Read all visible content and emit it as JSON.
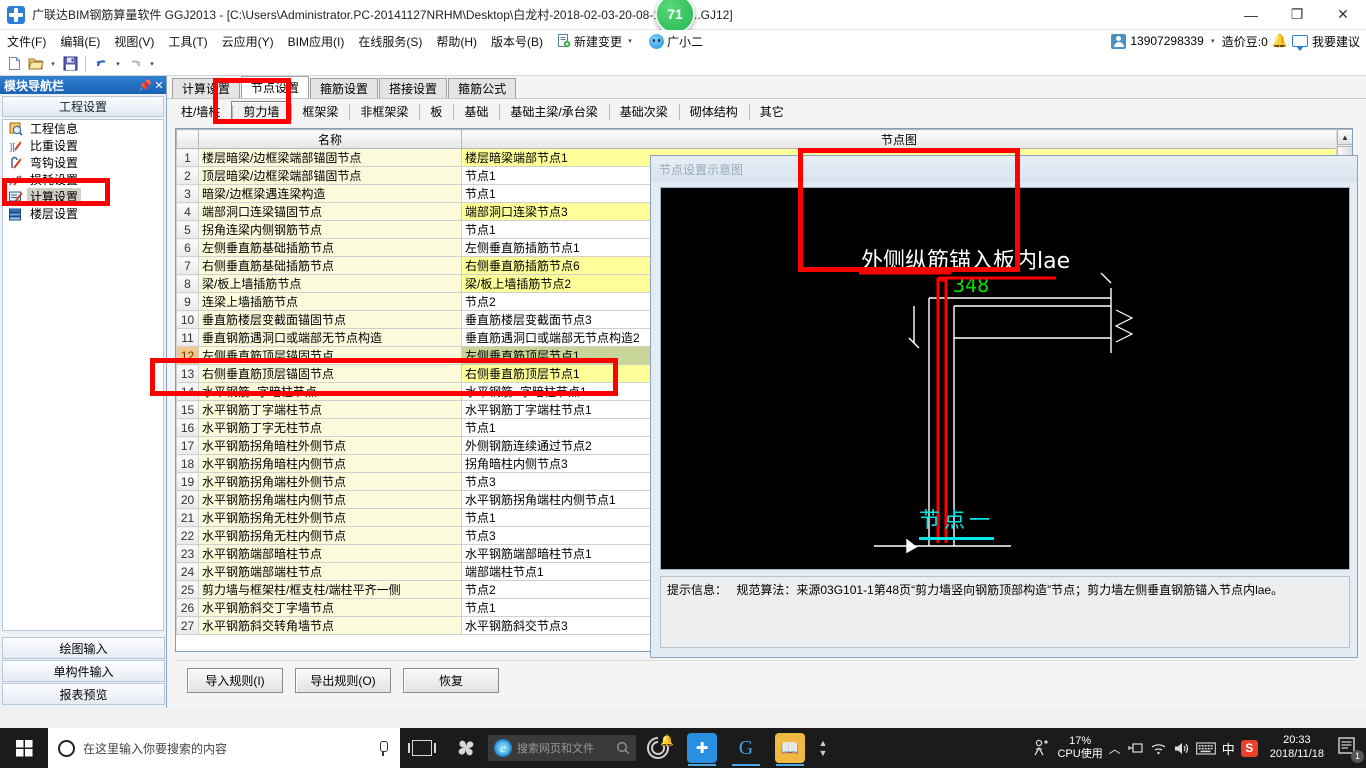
{
  "window": {
    "app_icon": "grandsoft-logo-icon",
    "title": "广联达BIM钢筋算量软件 GGJ2013 - [C:\\Users\\Administrator.PC-20141127NRHM\\Desktop\\白龙村-2018-02-03-20-08-17(266...GJ12]",
    "badge": "71",
    "minimize": "—",
    "maximize": "❐",
    "close": "✕"
  },
  "menubar": {
    "items": [
      "文件(F)",
      "编辑(E)",
      "视图(V)",
      "工具(T)",
      "云应用(Y)",
      "BIM应用(I)",
      "在线服务(S)",
      "帮助(H)",
      "版本号(B)"
    ],
    "new_change": "新建变更",
    "new_change_caret": "▾",
    "user_name": "广小二",
    "account": "13907298339",
    "account_caret": "▾",
    "beans": "造价豆:0",
    "suggest": "我要建议"
  },
  "toolbar": {
    "new_icon": "new-document-icon",
    "open_icon": "open-folder-icon",
    "save_icon": "save-disk-icon",
    "undo_icon": "undo-arrow-icon",
    "redo_icon": "redo-arrow-icon",
    "caret": "▾"
  },
  "sidebar": {
    "title": "模块导航栏",
    "pin_icon": "pin-icon",
    "close_icon": "close-icon",
    "group_title": "工程设置",
    "items": [
      {
        "label": "工程信息",
        "icon": "project-info-icon",
        "selected": false
      },
      {
        "label": "比重设置",
        "icon": "weight-setting-icon",
        "selected": false
      },
      {
        "label": "弯钩设置",
        "icon": "hook-setting-icon",
        "selected": false
      },
      {
        "label": "损耗设置",
        "icon": "loss-setting-icon",
        "selected": false
      },
      {
        "label": "计算设置",
        "icon": "calc-setting-icon",
        "selected": true
      },
      {
        "label": "楼层设置",
        "icon": "floor-setting-icon",
        "selected": false
      }
    ],
    "bottom_buttons": [
      "绘图输入",
      "单构件输入",
      "报表预览"
    ]
  },
  "tabs_primary": [
    {
      "label": "计算设置",
      "active": false
    },
    {
      "label": "节点设置",
      "active": true
    },
    {
      "label": "箍筋设置",
      "active": false
    },
    {
      "label": "搭接设置",
      "active": false
    },
    {
      "label": "箍筋公式",
      "active": false
    }
  ],
  "tabs_secondary": [
    {
      "label": "柱/墙柱",
      "active": false
    },
    {
      "label": "剪力墙",
      "active": true
    },
    {
      "label": "框架梁",
      "active": false
    },
    {
      "label": "非框架梁",
      "active": false
    },
    {
      "label": "板",
      "active": false
    },
    {
      "label": "基础",
      "active": false
    },
    {
      "label": "基础主梁/承台梁",
      "active": false
    },
    {
      "label": "基础次梁",
      "active": false
    },
    {
      "label": "砌体结构",
      "active": false
    },
    {
      "label": "其它",
      "active": false
    }
  ],
  "table": {
    "columns": [
      "",
      "名称",
      "节点图"
    ],
    "rows": [
      {
        "num": "1",
        "name": "楼层暗梁/边框梁端部锚固节点",
        "node": "楼层暗梁端部节点1",
        "node_highlight": true,
        "selected": false
      },
      {
        "num": "2",
        "name": "顶层暗梁/边框梁端部锚固节点",
        "node": "节点1",
        "node_highlight": false,
        "selected": false
      },
      {
        "num": "3",
        "name": "暗梁/边框梁遇连梁构造",
        "node": "节点1",
        "node_highlight": false,
        "selected": false
      },
      {
        "num": "4",
        "name": "端部洞口连梁锚固节点",
        "node": "端部洞口连梁节点3",
        "node_highlight": true,
        "selected": false
      },
      {
        "num": "5",
        "name": "拐角连梁内侧钢筋节点",
        "node": "节点1",
        "node_highlight": false,
        "selected": false
      },
      {
        "num": "6",
        "name": "左侧垂直筋基础插筋节点",
        "node": "左侧垂直筋插筋节点1",
        "node_highlight": false,
        "selected": false
      },
      {
        "num": "7",
        "name": "右侧垂直筋基础插筋节点",
        "node": "右侧垂直筋插筋节点6",
        "node_highlight": true,
        "selected": false
      },
      {
        "num": "8",
        "name": "梁/板上墙插筋节点",
        "node": "梁/板上墙插筋节点2",
        "node_highlight": true,
        "selected": false
      },
      {
        "num": "9",
        "name": "连梁上墙插筋节点",
        "node": "节点2",
        "node_highlight": false,
        "selected": false
      },
      {
        "num": "10",
        "name": "垂直筋楼层变截面锚固节点",
        "node": "垂直筋楼层变截面节点3",
        "node_highlight": false,
        "selected": false
      },
      {
        "num": "11",
        "name": "垂直钢筋遇洞口或端部无节点构造",
        "node": "垂直筋遇洞口或端部无节点构造2",
        "node_highlight": false,
        "selected": false
      },
      {
        "num": "12",
        "name": "左侧垂直筋顶层锚固节点",
        "node": "左侧垂直筋顶层节点1",
        "node_highlight": false,
        "selected": true
      },
      {
        "num": "13",
        "name": "右侧垂直筋顶层锚固节点",
        "node": "右侧垂直筋顶层节点1",
        "node_highlight": true,
        "selected": false
      },
      {
        "num": "14",
        "name": "水平钢筋⌐字暗柱节点",
        "node": "水平钢筋⌐字暗柱节点1",
        "node_highlight": false,
        "selected": false
      },
      {
        "num": "15",
        "name": "水平钢筋丁字端柱节点",
        "node": "水平钢筋丁字端柱节点1",
        "node_highlight": false,
        "selected": false
      },
      {
        "num": "16",
        "name": "水平钢筋丁字无柱节点",
        "node": "节点1",
        "node_highlight": false,
        "selected": false
      },
      {
        "num": "17",
        "name": "水平钢筋拐角暗柱外侧节点",
        "node": "外侧钢筋连续通过节点2",
        "node_highlight": false,
        "selected": false
      },
      {
        "num": "18",
        "name": "水平钢筋拐角暗柱内侧节点",
        "node": "拐角暗柱内侧节点3",
        "node_highlight": false,
        "selected": false
      },
      {
        "num": "19",
        "name": "水平钢筋拐角端柱外侧节点",
        "node": "节点3",
        "node_highlight": false,
        "selected": false
      },
      {
        "num": "20",
        "name": "水平钢筋拐角端柱内侧节点",
        "node": "水平钢筋拐角端柱内侧节点1",
        "node_highlight": false,
        "selected": false
      },
      {
        "num": "21",
        "name": "水平钢筋拐角无柱外侧节点",
        "node": "节点1",
        "node_highlight": false,
        "selected": false
      },
      {
        "num": "22",
        "name": "水平钢筋拐角无柱内侧节点",
        "node": "节点3",
        "node_highlight": false,
        "selected": false
      },
      {
        "num": "23",
        "name": "水平钢筋端部暗柱节点",
        "node": "水平钢筋端部暗柱节点1",
        "node_highlight": false,
        "selected": false
      },
      {
        "num": "24",
        "name": "水平钢筋端部端柱节点",
        "node": "端部端柱节点1",
        "node_highlight": false,
        "selected": false
      },
      {
        "num": "25",
        "name": "剪力墙与框架柱/框支柱/端柱平齐一侧",
        "node": "节点2",
        "node_highlight": false,
        "selected": false
      },
      {
        "num": "26",
        "name": "水平钢筋斜交丁字墙节点",
        "node": "节点1",
        "node_highlight": false,
        "selected": false
      },
      {
        "num": "27",
        "name": "水平钢筋斜交转角墙节点",
        "node": "水平钢筋斜交节点3",
        "node_highlight": false,
        "selected": false
      }
    ]
  },
  "footer_buttons": [
    "导入规则(I)",
    "导出规则(O)",
    "恢复"
  ],
  "diagram": {
    "title": "节点设置示意图",
    "canvas_text": "外侧纵筋锚入板内lae",
    "canvas_value": "348",
    "canvas_label": "节点一",
    "hint_prefix": "提示信息：",
    "hint_text": "规范算法：来源03G101-1第48页“剪力墙竖向钢筋顶部构造”节点；剪力墙左侧垂直钢筋锚入节点内lae。"
  },
  "annotations": {
    "box_tabs": "highlight-node-setting-tabs",
    "box_sidebar": "highlight-calc-setting",
    "box_rows": "highlight-rows-12-13",
    "box_canvas": "highlight-canvas-text"
  },
  "taskbar": {
    "start_icon": "windows-start-icon",
    "search_placeholder": "在这里输入你要搜索的内容",
    "cortana_icon": "cortana-circle-icon",
    "mic_icon": "microphone-icon",
    "taskview_icon": "task-view-icon",
    "fan_icon": "app-fan-icon",
    "ie_search_placeholder": "搜索网页和文件",
    "ie_icon": "internet-explorer-icon",
    "apps": [
      {
        "icon": "spiral-app-icon",
        "running": false
      },
      {
        "icon": "grandsoft-app-icon",
        "running": true
      },
      {
        "icon": "browser-g-app-icon",
        "running": true
      },
      {
        "icon": "dictionary-app-icon",
        "running": true
      }
    ],
    "scroll_up": "▲",
    "scroll_down": "▼",
    "people_icon": "people-icon",
    "cpu_percent": "17%",
    "cpu_label": "CPU使用",
    "chevron_up": "︿",
    "plug_icon": "usb-device-icon",
    "wifi_icon": "wifi-icon",
    "volume_icon": "volume-icon",
    "keyboard_icon": "keyboard-icon",
    "ime_label": "中",
    "sogou_icon": "sogou-ime-icon",
    "time": "20:33",
    "date": "2018/11/18",
    "notif_icon": "notification-icon",
    "notif_count": "1"
  }
}
